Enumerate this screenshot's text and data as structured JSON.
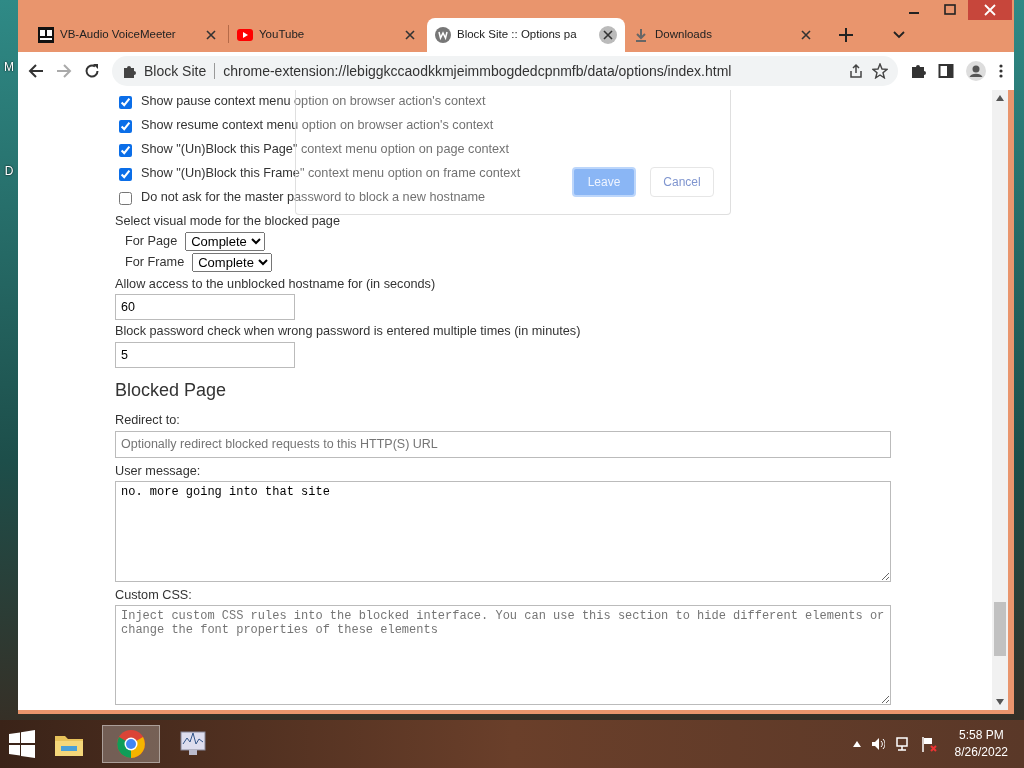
{
  "desktop_labels": [
    "M",
    "D"
  ],
  "tabs": [
    {
      "title": "VB-Audio VoiceMeeter",
      "kind": "vb",
      "selected": false
    },
    {
      "title": "YouTube",
      "kind": "youtube",
      "selected": false
    },
    {
      "title": "Block Site :: Options pa",
      "kind": "w",
      "selected": true
    },
    {
      "title": "Downloads",
      "kind": "download",
      "selected": false
    }
  ],
  "address_bar": {
    "site_label": "Block Site",
    "url": "chrome-extension://lebiggkccaodkkmjeimmbogdedcpnmfb/data/options/index.html"
  },
  "options": [
    {
      "label": "Show pause context menu option on browser action's context",
      "checked": true
    },
    {
      "label": "Show resume context menu option on browser action's context",
      "checked": true
    },
    {
      "label": "Show \"(Un)Block this Page\" context menu option on page context",
      "checked": true
    },
    {
      "label": "Show \"(Un)Block this Frame\" context menu option on frame context",
      "checked": true
    },
    {
      "label": "Do not ask for the master password to block a new hostname",
      "checked": false
    }
  ],
  "visual_mode": {
    "label": "Select visual mode for the blocked page",
    "selects": [
      {
        "label": "For Page",
        "value": "Complete"
      },
      {
        "label": "For Frame",
        "value": "Complete"
      }
    ]
  },
  "number_fields": [
    {
      "label": "Allow access to the unblocked hostname for (in seconds)",
      "value": "60"
    },
    {
      "label": "Block password check when wrong password is entered multiple times (in minutes)",
      "value": "5"
    }
  ],
  "blocked_page": {
    "heading": "Blocked Page",
    "redirect": {
      "label": "Redirect to:",
      "placeholder": "Optionally redirect blocked requests to this HTTP(S) URL"
    },
    "user_message": {
      "label": "User message:",
      "value": "no. more going into that site"
    },
    "custom_css": {
      "label": "Custom CSS:",
      "placeholder": "Inject custom CSS rules into the blocked interface. You can use this section to hide different elements or change the font properties of these elements"
    }
  },
  "dialog": {
    "buttons": [
      {
        "label": "Leave",
        "kind": "primary"
      },
      {
        "label": "Cancel",
        "kind": "secondary"
      }
    ]
  },
  "taskbar": {
    "apps": [
      {
        "kind": "explorer",
        "selected": false
      },
      {
        "kind": "chrome",
        "selected": true
      },
      {
        "kind": "monitor",
        "selected": false
      }
    ],
    "time": "5:58 PM",
    "date": "8/26/2022"
  }
}
